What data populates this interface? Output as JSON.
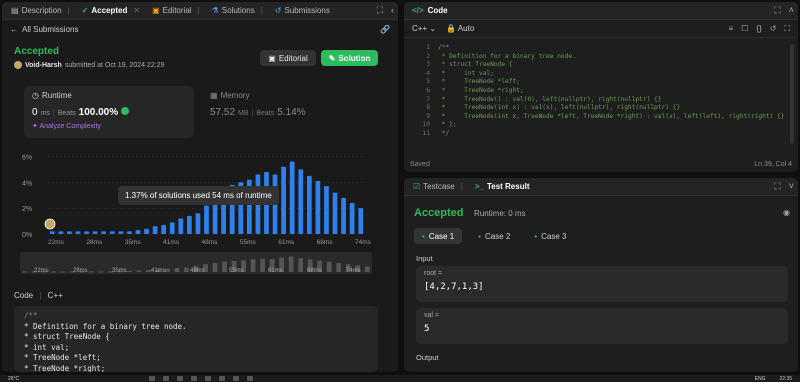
{
  "left_tabs": [
    {
      "label": "Description",
      "icon": "description-icon"
    },
    {
      "label": "Accepted",
      "icon": "accepted-icon"
    },
    {
      "label": "Editorial",
      "icon": "editorial-icon"
    },
    {
      "label": "Solutions",
      "icon": "solutions-icon"
    },
    {
      "label": "Submissions",
      "icon": "submissions-icon"
    }
  ],
  "back_label": "All Submissions",
  "result": {
    "status": "Accepted",
    "user": "Void-Harsh",
    "submitted_text": "submitted at Oct 19, 2024 22:29"
  },
  "buttons": {
    "editorial": "Editorial",
    "solution": "Solution"
  },
  "runtime": {
    "label": "Runtime",
    "value": "0",
    "unit": "ms",
    "beats_label": "Beats",
    "beats_value": "100.00%",
    "analyze": "Analyze Complexity"
  },
  "memory": {
    "label": "Memory",
    "value": "57.52",
    "unit": "MB",
    "beats_label": "Beats",
    "beats_value": "5.14%"
  },
  "tooltip": "1.37% of solutions used 54 ms of runtime",
  "chart_data": {
    "type": "bar",
    "y_ticks": [
      "6%",
      "4%",
      "2%",
      "0%"
    ],
    "ylim": [
      0,
      6.5
    ],
    "x_ticks": [
      "22ms",
      "28ms",
      "35ms",
      "41ms",
      "48ms",
      "55ms",
      "61ms",
      "68ms",
      "74ms"
    ],
    "brush_ticks": [
      "22ms",
      "28ms",
      "35ms",
      "41ms",
      "48ms",
      "55ms",
      "61ms",
      "68ms",
      "74ms"
    ],
    "x": [
      22,
      23.5,
      25,
      26.5,
      28,
      29.5,
      31,
      32.5,
      34,
      35.5,
      37,
      38.5,
      40,
      41.5,
      43,
      44.5,
      46,
      47.5,
      49,
      50.5,
      52,
      53.5,
      55,
      56.5,
      58,
      59.5,
      61,
      62.5,
      64,
      65.5,
      67,
      68.5,
      70,
      71.5,
      73,
      74.5,
      76
    ],
    "values": [
      0.2,
      0.2,
      0.2,
      0.2,
      0.2,
      0.2,
      0.2,
      0.2,
      0.2,
      0.2,
      0.3,
      0.4,
      0.6,
      0.7,
      0.9,
      1.2,
      1.4,
      1.6,
      2.2,
      2.8,
      3.2,
      3.8,
      4.0,
      4.2,
      4.6,
      4.8,
      4.6,
      5.2,
      5.6,
      5.0,
      4.5,
      4.1,
      3.7,
      3.2,
      2.8,
      2.4,
      2.0
    ],
    "highlight_index": 21,
    "bar_color": "#2f80ed",
    "dim_color": "#3a3a3a"
  },
  "code_section": {
    "label": "Code",
    "lang": "C++"
  },
  "left_code_lines": [
    "/**",
    " * Definition for a binary tree node.",
    " * struct TreeNode {",
    " *     int val;",
    " *     TreeNode *left;",
    " *     TreeNode *right;"
  ],
  "code_panel": {
    "title": "Code",
    "lang": "C++",
    "mode": "Auto",
    "saved": "Saved",
    "cursor": "Ln 39, Col 4"
  },
  "editor_lines": [
    "/**",
    " * Definition for a binary tree node.",
    " * struct TreeNode {",
    " *     int val;",
    " *     TreeNode *left;",
    " *     TreeNode *right;",
    " *     TreeNode() : val(0), left(nullptr), right(nullptr) {}",
    " *     TreeNode(int x) : val(x), left(nullptr), right(nullptr) {}",
    " *     TreeNode(int x, TreeNode *left, TreeNode *right) : val(x), left(left), right(right) {}",
    " * };",
    " */"
  ],
  "line_numbers": [
    "1",
    "2",
    "3",
    "4",
    "5",
    "6",
    "7",
    "8",
    "9",
    "10",
    "11"
  ],
  "test_tabs": [
    {
      "label": "Testcase",
      "icon": "testcase-icon"
    },
    {
      "label": "Test Result",
      "icon": "terminal-icon"
    }
  ],
  "test_result": {
    "status": "Accepted",
    "runtime": "Runtime: 0 ms",
    "cases": [
      "Case 1",
      "Case 2",
      "Case 3"
    ],
    "input_label": "Input",
    "inputs": [
      {
        "name": "root =",
        "value": "[4,2,7,1,3]"
      },
      {
        "name": "val =",
        "value": "5"
      }
    ],
    "output_label": "Output"
  },
  "taskbar": {
    "weather": "26°C",
    "lang": "ENG",
    "time": "22:35"
  }
}
